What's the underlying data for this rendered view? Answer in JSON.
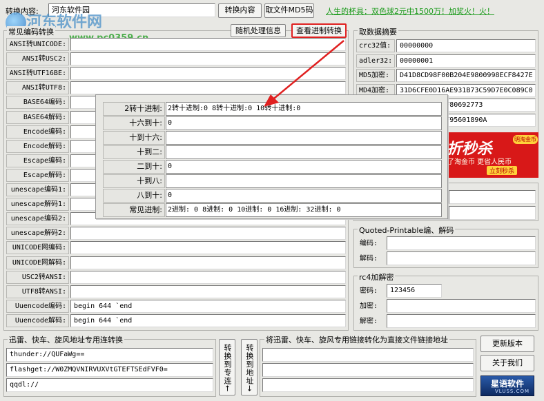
{
  "top": {
    "content_label": "转换内容:",
    "content_value": "河东软件园",
    "convert_button": "转换内容",
    "md5_button": "取文件MD5码",
    "ad_text": "人生的杯具：双色球2元中1500万！加奖火！火！"
  },
  "watermark": {
    "site": "河东软件网",
    "url": "www.pc0359.cn"
  },
  "left_panel": {
    "title": "常见编码转换",
    "random_button": "随机处理信息",
    "radix_button": "查看进制转换",
    "rows": [
      {
        "label": "ANSI转UNICODE:",
        "value": ""
      },
      {
        "label": "ANSI转USC2:",
        "value": ""
      },
      {
        "label": "ANSI转UTF16BE:",
        "value": ""
      },
      {
        "label": "ANSI转UTF8:",
        "value": ""
      },
      {
        "label": "BASE64编码:",
        "value": ""
      },
      {
        "label": "BASE64解码:",
        "value": ""
      },
      {
        "label": "Encode编码:",
        "value": ""
      },
      {
        "label": "Encode解码:",
        "value": ""
      },
      {
        "label": "Escape编码:",
        "value": ""
      },
      {
        "label": "Escape解码:",
        "value": ""
      },
      {
        "label": "unescape编码1:",
        "value": ""
      },
      {
        "label": "unescape解码1:",
        "value": ""
      },
      {
        "label": "unescape编码2:",
        "value": ""
      },
      {
        "label": "unescape解码2:",
        "value": ""
      },
      {
        "label": "UNICODE网编码:",
        "value": ""
      },
      {
        "label": "UNICODE网解码:",
        "value": ""
      },
      {
        "label": "USC2转ANSI:",
        "value": ""
      },
      {
        "label": "UTF8转ANSI:",
        "value": ""
      },
      {
        "label": "Uuencode编码:",
        "value": "begin 644 `end"
      },
      {
        "label": "Uuencode解码:",
        "value": "begin 644 `end"
      }
    ]
  },
  "digest": {
    "title": "取数据摘要",
    "rows": [
      {
        "label": "crc32值:",
        "value": "00000000"
      },
      {
        "label": "adler32:",
        "value": "00000001"
      },
      {
        "label": "MD5加密:",
        "value": "D41D8CD98F00B204E9800998ECF8427E"
      },
      {
        "label": "MD4加密:",
        "value": "31D6CFE0D16AE931B73C59D7E0C089C0"
      },
      {
        "label": "",
        "value": "153DF2275C9F80692773"
      },
      {
        "label": "",
        "value": "4B0D3255BFEF95601890A"
      }
    ]
  },
  "banner": {
    "big": "折秒杀",
    "small": "了淘金币 更省人民币",
    "button": "立刻秒杀",
    "badge": "明淘金币"
  },
  "quoted": {
    "title": "Quoted-Printable编、解码",
    "encode_label": "编码:",
    "encode_value": "",
    "decode_label": "解码:",
    "decode_value": ""
  },
  "rc4": {
    "title": "rc4加解密",
    "key_label": "密码:",
    "key_value": "123456",
    "enc_label": "加密:",
    "enc_value": "",
    "dec_label": "解密:",
    "dec_value": ""
  },
  "thunder": {
    "title": "迅雷、快车、旋风地址专用连转换",
    "values": [
      "thunder://QUFaWg==",
      "flashget://W0ZMQVNIRVUXVtGTEFTSEdFVF0=",
      "qqdl://"
    ],
    "to_special_button": "转换到专连←",
    "to_address_button": "转换到地址→"
  },
  "direct": {
    "title": "将迅雷、快车、旋风专用链接转化为直接文件链接地址",
    "values": [
      "",
      "",
      ""
    ]
  },
  "side_buttons": {
    "update": "更新版本",
    "about": "关于我们",
    "logo": "星语软件",
    "logo_sub": "VLUSS.COM"
  },
  "popup": {
    "rows": [
      {
        "label": "2转十进制:",
        "value": "2转十进制:0  8转十进制:0  10转十进制:0"
      },
      {
        "label": "十六到十:",
        "value": "0"
      },
      {
        "label": "十到十六:",
        "value": ""
      },
      {
        "label": "十到二:",
        "value": ""
      },
      {
        "label": "二到十:",
        "value": "0"
      },
      {
        "label": "十到八:",
        "value": ""
      },
      {
        "label": "八到十:",
        "value": "0"
      },
      {
        "label": "常见进制:",
        "value": "2进制: 0   8进制: 0 10进制: 0 16进制:  32进制: 0"
      }
    ]
  },
  "colors": {
    "ad_green": "#1a9a1a",
    "highlight_red": "#e02020",
    "arrow_red": "#e02020",
    "logo_blue": "#1a3a7a"
  }
}
